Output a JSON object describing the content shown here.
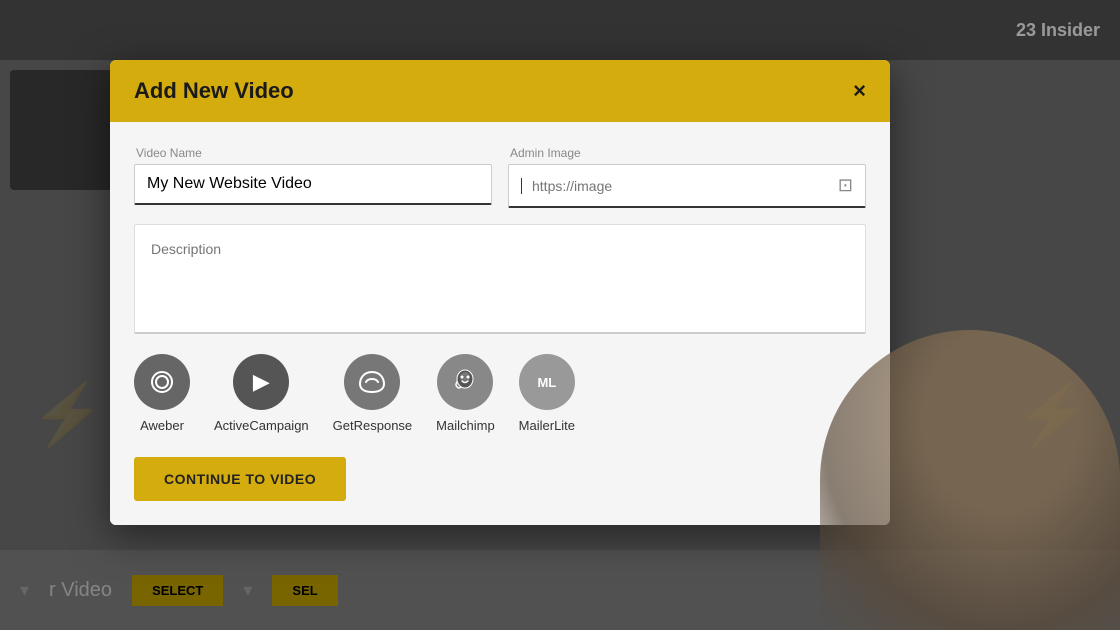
{
  "background": {
    "insider_label": "23 Insider",
    "bottom_video_label": "r Video",
    "select_btn": "SELECT",
    "sel_btn": "SEL"
  },
  "modal": {
    "title": "Add New Video",
    "close_icon": "×",
    "video_name_label": "Video Name",
    "video_name_value": "My New Website Video",
    "admin_image_label": "Admin Image",
    "admin_image_placeholder": "https://image",
    "description_placeholder": "Description",
    "integrations_title": "",
    "integrations": [
      {
        "id": "aweber",
        "label": "Aweber",
        "icon_text": "((◉))"
      },
      {
        "id": "activecampaign",
        "label": "ActiveCampaign",
        "icon_text": "▶"
      },
      {
        "id": "getresponse",
        "label": "GetResponse",
        "icon_text": "✉"
      },
      {
        "id": "mailchimp",
        "label": "Mailchimp",
        "icon_text": "🐵"
      },
      {
        "id": "mailerlite",
        "label": "MailerLite",
        "icon_text": "ML"
      }
    ],
    "continue_btn_label": "CONTINUE TO VIDEO"
  }
}
